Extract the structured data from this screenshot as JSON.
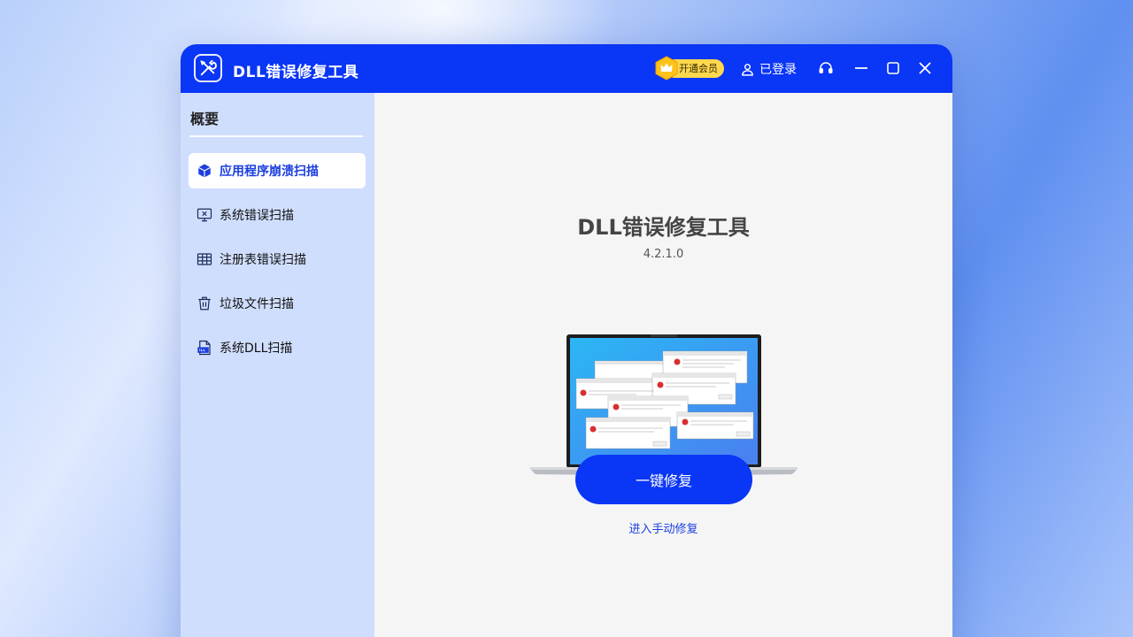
{
  "app": {
    "title": "DLL错误修复工具",
    "brand_color": "#0a36f5"
  },
  "titlebar": {
    "vip_label": "开通会员",
    "login_label": "已登录",
    "icons": [
      "headset-icon",
      "minimize-icon",
      "maximize-icon",
      "close-icon"
    ]
  },
  "sidebar": {
    "title": "概要",
    "items": [
      {
        "label": "应用程序崩溃扫描",
        "icon": "cube-icon",
        "active": true
      },
      {
        "label": "系统错误扫描",
        "icon": "monitor-error-icon",
        "active": false
      },
      {
        "label": "注册表错误扫描",
        "icon": "table-icon",
        "active": false
      },
      {
        "label": "垃圾文件扫描",
        "icon": "trash-icon",
        "active": false
      },
      {
        "label": "系统DLL扫描",
        "icon": "dll-file-icon",
        "active": false
      }
    ]
  },
  "main": {
    "title": "DLL错误修复工具",
    "version": "4.2.1.0",
    "fix_button": "一键修复",
    "manual_link": "进入手动修复"
  }
}
